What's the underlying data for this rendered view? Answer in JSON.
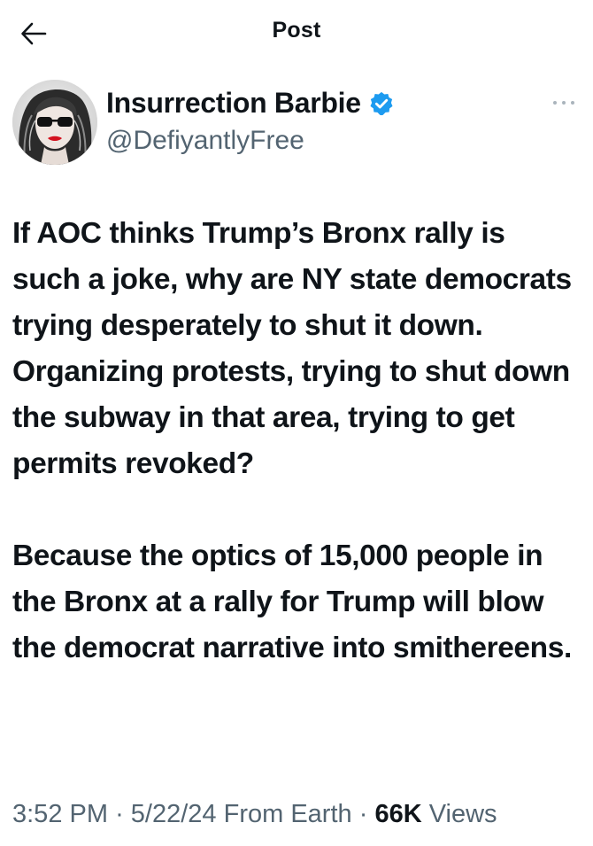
{
  "header": {
    "title": "Post",
    "back_icon": "arrow-left-icon"
  },
  "author": {
    "display_name": "Insurrection Barbie",
    "handle": "@DefiyantlyFree",
    "verified": true,
    "verified_color": "#1d9bf0",
    "avatar_icon": "avatar-woman-sunglasses"
  },
  "post": {
    "paragraphs": [
      "If AOC thinks Trump’s Bronx rally is such a joke, why are NY state democrats trying desperately to shut it down. Organizing protests, trying to shut down the subway in that area, trying to get permits revoked?",
      "Because the optics of 15,000 people in the Bronx at a rally for Trump will blow the democrat narrative into smithereens."
    ]
  },
  "meta": {
    "time": "3:52 PM",
    "separator": "·",
    "date": "5/22/24",
    "source": "From Earth",
    "views_count": "66K",
    "views_label": "Views"
  },
  "colors": {
    "text": "#0f1419",
    "secondary": "#536471",
    "accent": "#1d9bf0"
  }
}
